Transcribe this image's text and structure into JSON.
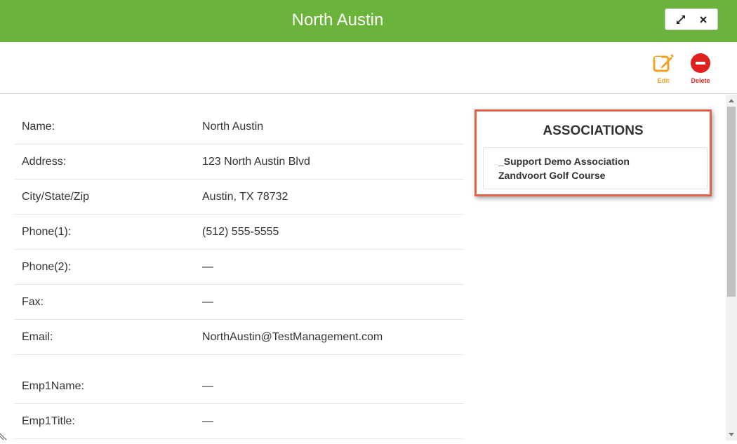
{
  "window": {
    "title": "North Austin"
  },
  "toolbar": {
    "edit_label": "Edit",
    "delete_label": "Delete"
  },
  "details": [
    {
      "label": "Name:",
      "value": "North Austin"
    },
    {
      "label": "Address:",
      "value": "123 North Austin Blvd"
    },
    {
      "label": "City/State/Zip",
      "value": "Austin, TX 78732"
    },
    {
      "label": "Phone(1):",
      "value": "(512) 555-5555"
    },
    {
      "label": "Phone(2):",
      "value": "—"
    },
    {
      "label": "Fax:",
      "value": "—"
    },
    {
      "label": "Email:",
      "value": "NorthAustin@TestManagement.com"
    },
    {
      "label": "Emp1Name:",
      "value": "—"
    },
    {
      "label": "Emp1Title:",
      "value": "—"
    }
  ],
  "associations": {
    "title": "ASSOCIATIONS",
    "items": [
      "_Support Demo Association",
      "Zandvoort Golf Course"
    ]
  },
  "colors": {
    "titlebar": "#6bb33b",
    "edit": "#f2a122",
    "delete": "#e0201f",
    "highlight_border": "#e16349"
  },
  "icons": {
    "expand": "expand-icon",
    "close": "close-icon",
    "edit": "edit-icon",
    "delete": "delete-icon"
  }
}
